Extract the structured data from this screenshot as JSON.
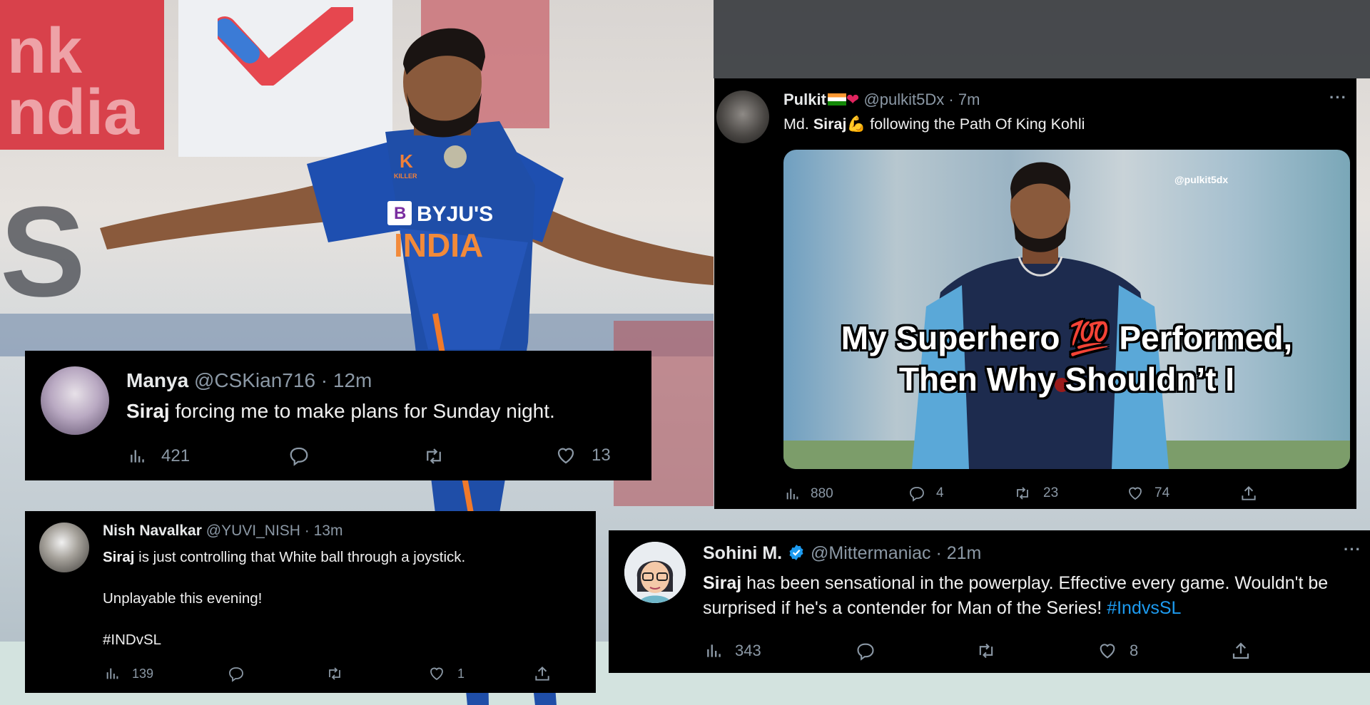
{
  "tweets": {
    "manya": {
      "name": "Manya",
      "handle": "@CSKian716",
      "time": "12m",
      "highlight": "Siraj",
      "text": " forcing me to make plans for Sunday night.",
      "views": "421",
      "likes": "13"
    },
    "nish": {
      "name": "Nish Navalkar",
      "handle": "@YUVI_NISH",
      "time": "13m",
      "highlight": "Siraj",
      "text": " is just controlling that White ball through a joystick.",
      "text2": "Unplayable this evening!",
      "hashtag": "#INDvSL",
      "views": "139",
      "likes": "1"
    },
    "pulkit": {
      "name": "Pulkit",
      "handle": "@pulkit5Dx",
      "time": "7m",
      "text_pre": "Md. ",
      "highlight": "Siraj",
      "text": " following the Path Of King Kohli",
      "media_watermark": "@pulkit5dx",
      "media_caption_1": "My Superhero 💯 Performed,",
      "media_caption_2": "Then Why Shouldn’t I",
      "views": "880",
      "replies": "4",
      "retweets": "23",
      "likes": "74",
      "more": "···"
    },
    "sohini": {
      "name": "Sohini M.",
      "handle": "@Mittermaniac",
      "time": "21m",
      "highlight": "Siraj",
      "text": " has been sensational in the powerplay. Effective every game. Wouldn't be surprised if he's a contender for Man of the Series! ",
      "hashtag": "#IndvsSL",
      "views": "343",
      "likes": "8",
      "more": "···"
    }
  },
  "background": {
    "jersey_sponsor": "BYJU'S",
    "jersey_team": "INDIA",
    "jersey_brand": "KILLER"
  },
  "colors": {
    "card_bg": "#000000",
    "text": "#e7e9ea",
    "muted": "#8b98a5",
    "link": "#1d9bf0",
    "jersey_blue": "#1f4ea8"
  },
  "icons": [
    "views-icon",
    "reply-icon",
    "retweet-icon",
    "like-icon",
    "share-icon",
    "more-icon",
    "verified-icon"
  ]
}
